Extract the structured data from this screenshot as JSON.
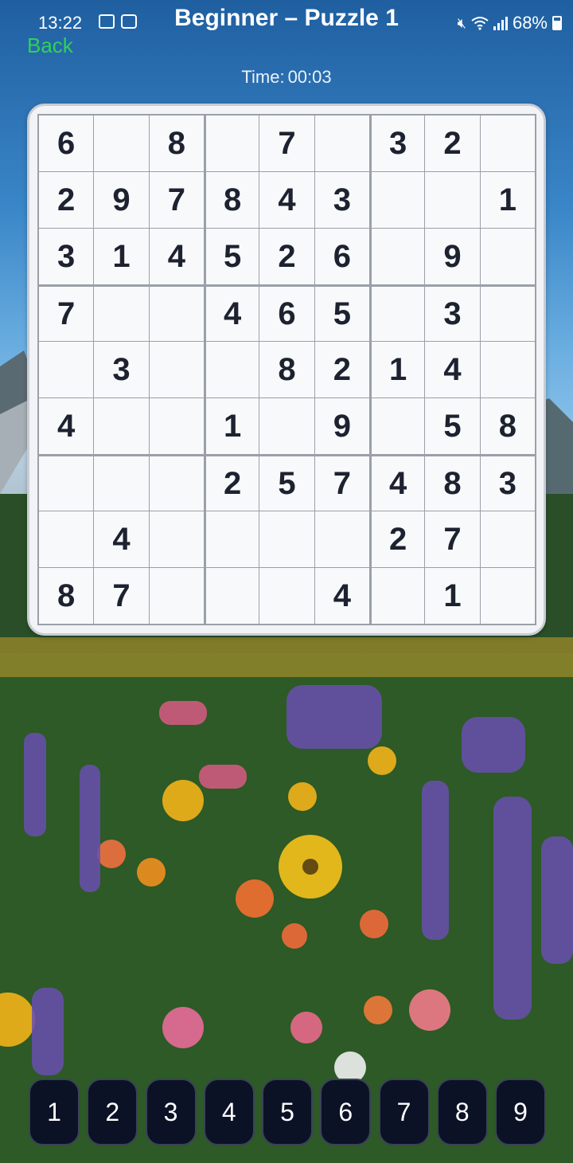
{
  "status_bar": {
    "time": "13:22",
    "battery": "68%"
  },
  "header": {
    "title": "Beginner – Puzzle 1",
    "back_label": "Back"
  },
  "timer": {
    "label": "Time:",
    "value": "00:03"
  },
  "board": [
    [
      "6",
      "",
      "8",
      "",
      "7",
      "",
      "3",
      "2",
      ""
    ],
    [
      "2",
      "9",
      "7",
      "8",
      "4",
      "3",
      "",
      "",
      "1"
    ],
    [
      "3",
      "1",
      "4",
      "5",
      "2",
      "6",
      "",
      "9",
      ""
    ],
    [
      "7",
      "",
      "",
      "4",
      "6",
      "5",
      "",
      "3",
      ""
    ],
    [
      "",
      "3",
      "",
      "",
      "8",
      "2",
      "1",
      "4",
      ""
    ],
    [
      "4",
      "",
      "",
      "1",
      "",
      "9",
      "",
      "5",
      "8"
    ],
    [
      "",
      "",
      "",
      "2",
      "5",
      "7",
      "4",
      "8",
      "3"
    ],
    [
      "",
      "4",
      "",
      "",
      "",
      "",
      "2",
      "7",
      ""
    ],
    [
      "8",
      "7",
      "",
      "",
      "",
      "4",
      "",
      "1",
      ""
    ]
  ],
  "numpad": [
    "1",
    "2",
    "3",
    "4",
    "5",
    "6",
    "7",
    "8",
    "9"
  ],
  "icons": {
    "gallery": "gallery-icon",
    "mail": "mail-icon",
    "mute": "mute-icon",
    "wifi": "wifi-icon",
    "signal": "signal-icon",
    "battery": "battery-icon"
  }
}
